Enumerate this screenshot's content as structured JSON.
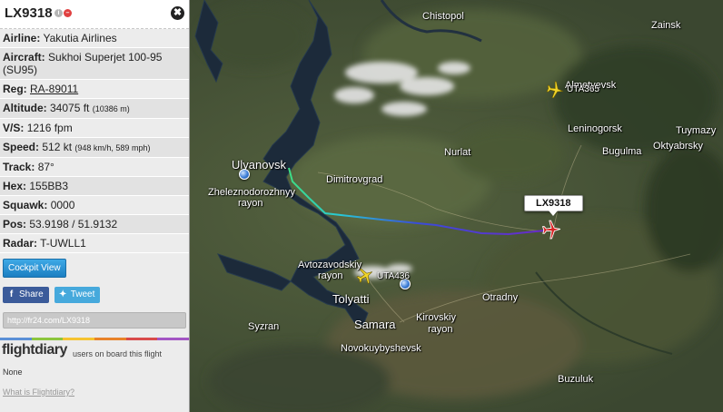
{
  "flight": {
    "callsign": "LX9318",
    "close_glyph": "✖",
    "fields": [
      {
        "label": "Airline:",
        "value": "Yakutia Airlines",
        "small": ""
      },
      {
        "label": "Aircraft:",
        "value": "Sukhoi Superjet 100-95 (SU95)",
        "small": ""
      },
      {
        "label": "Reg:",
        "value": "RA-89011",
        "small": ""
      },
      {
        "label": "Altitude:",
        "value": "34075 ft",
        "small": "(10386 m)"
      },
      {
        "label": "V/S:",
        "value": "1216 fpm",
        "small": ""
      },
      {
        "label": "Speed:",
        "value": "512 kt",
        "small": "(948 km/h, 589 mph)"
      },
      {
        "label": "Track:",
        "value": "87°",
        "small": ""
      },
      {
        "label": "Hex:",
        "value": "155BB3",
        "small": ""
      },
      {
        "label": "Squawk:",
        "value": "0000",
        "small": ""
      },
      {
        "label": "Pos:",
        "value": "53.9198 / 51.9132",
        "small": ""
      },
      {
        "label": "Radar:",
        "value": "T-UWLL1",
        "small": ""
      }
    ],
    "cockpit_view_label": "Cockpit View",
    "share_label": "Share",
    "tweet_label": "Tweet",
    "url": "http://fr24.com/LX9318"
  },
  "flightdiary": {
    "logo": "flightdiary",
    "users_text": "users on board this flight",
    "users_value": "None",
    "what_link": "What is Flightdiary?"
  },
  "map": {
    "selected_label": "LX9318",
    "other_flights": [
      "UTA365",
      "UTA436"
    ],
    "places": {
      "chistopol": "Chistopol",
      "zainsk": "Zainsk",
      "almetyevsk": "Almetyevsk",
      "leninogorsk": "Leninogorsk",
      "tuymazy": "Tuymazy",
      "bugulma": "Bugulma",
      "oktyabrsky": "Oktyabrsky",
      "nurlat": "Nurlat",
      "ulyanovsk": "Ulyanovsk",
      "dimitrovgrad": "Dimitrovgrad",
      "zheleznodorozhny": "Zheleznodorozhnyy",
      "rayon1": "rayon",
      "avtozavodsky": "Avtozavodskiy",
      "rayon2": "rayon",
      "tolyatti": "Tolyatti",
      "samara": "Samara",
      "kirovsky": "Kirovskiy",
      "rayon3": "rayon",
      "otradny": "Otradny",
      "syzran": "Syzran",
      "novokuybyshevsk": "Novokuybyshevsk",
      "buzuluk": "Buzuluk"
    }
  },
  "colors": {
    "selected_plane": "#d62222",
    "other_plane": "#f0d42a",
    "facebook": "#3b5b9a",
    "twitter": "#46a9dc",
    "cockpit": "#2690d4"
  }
}
